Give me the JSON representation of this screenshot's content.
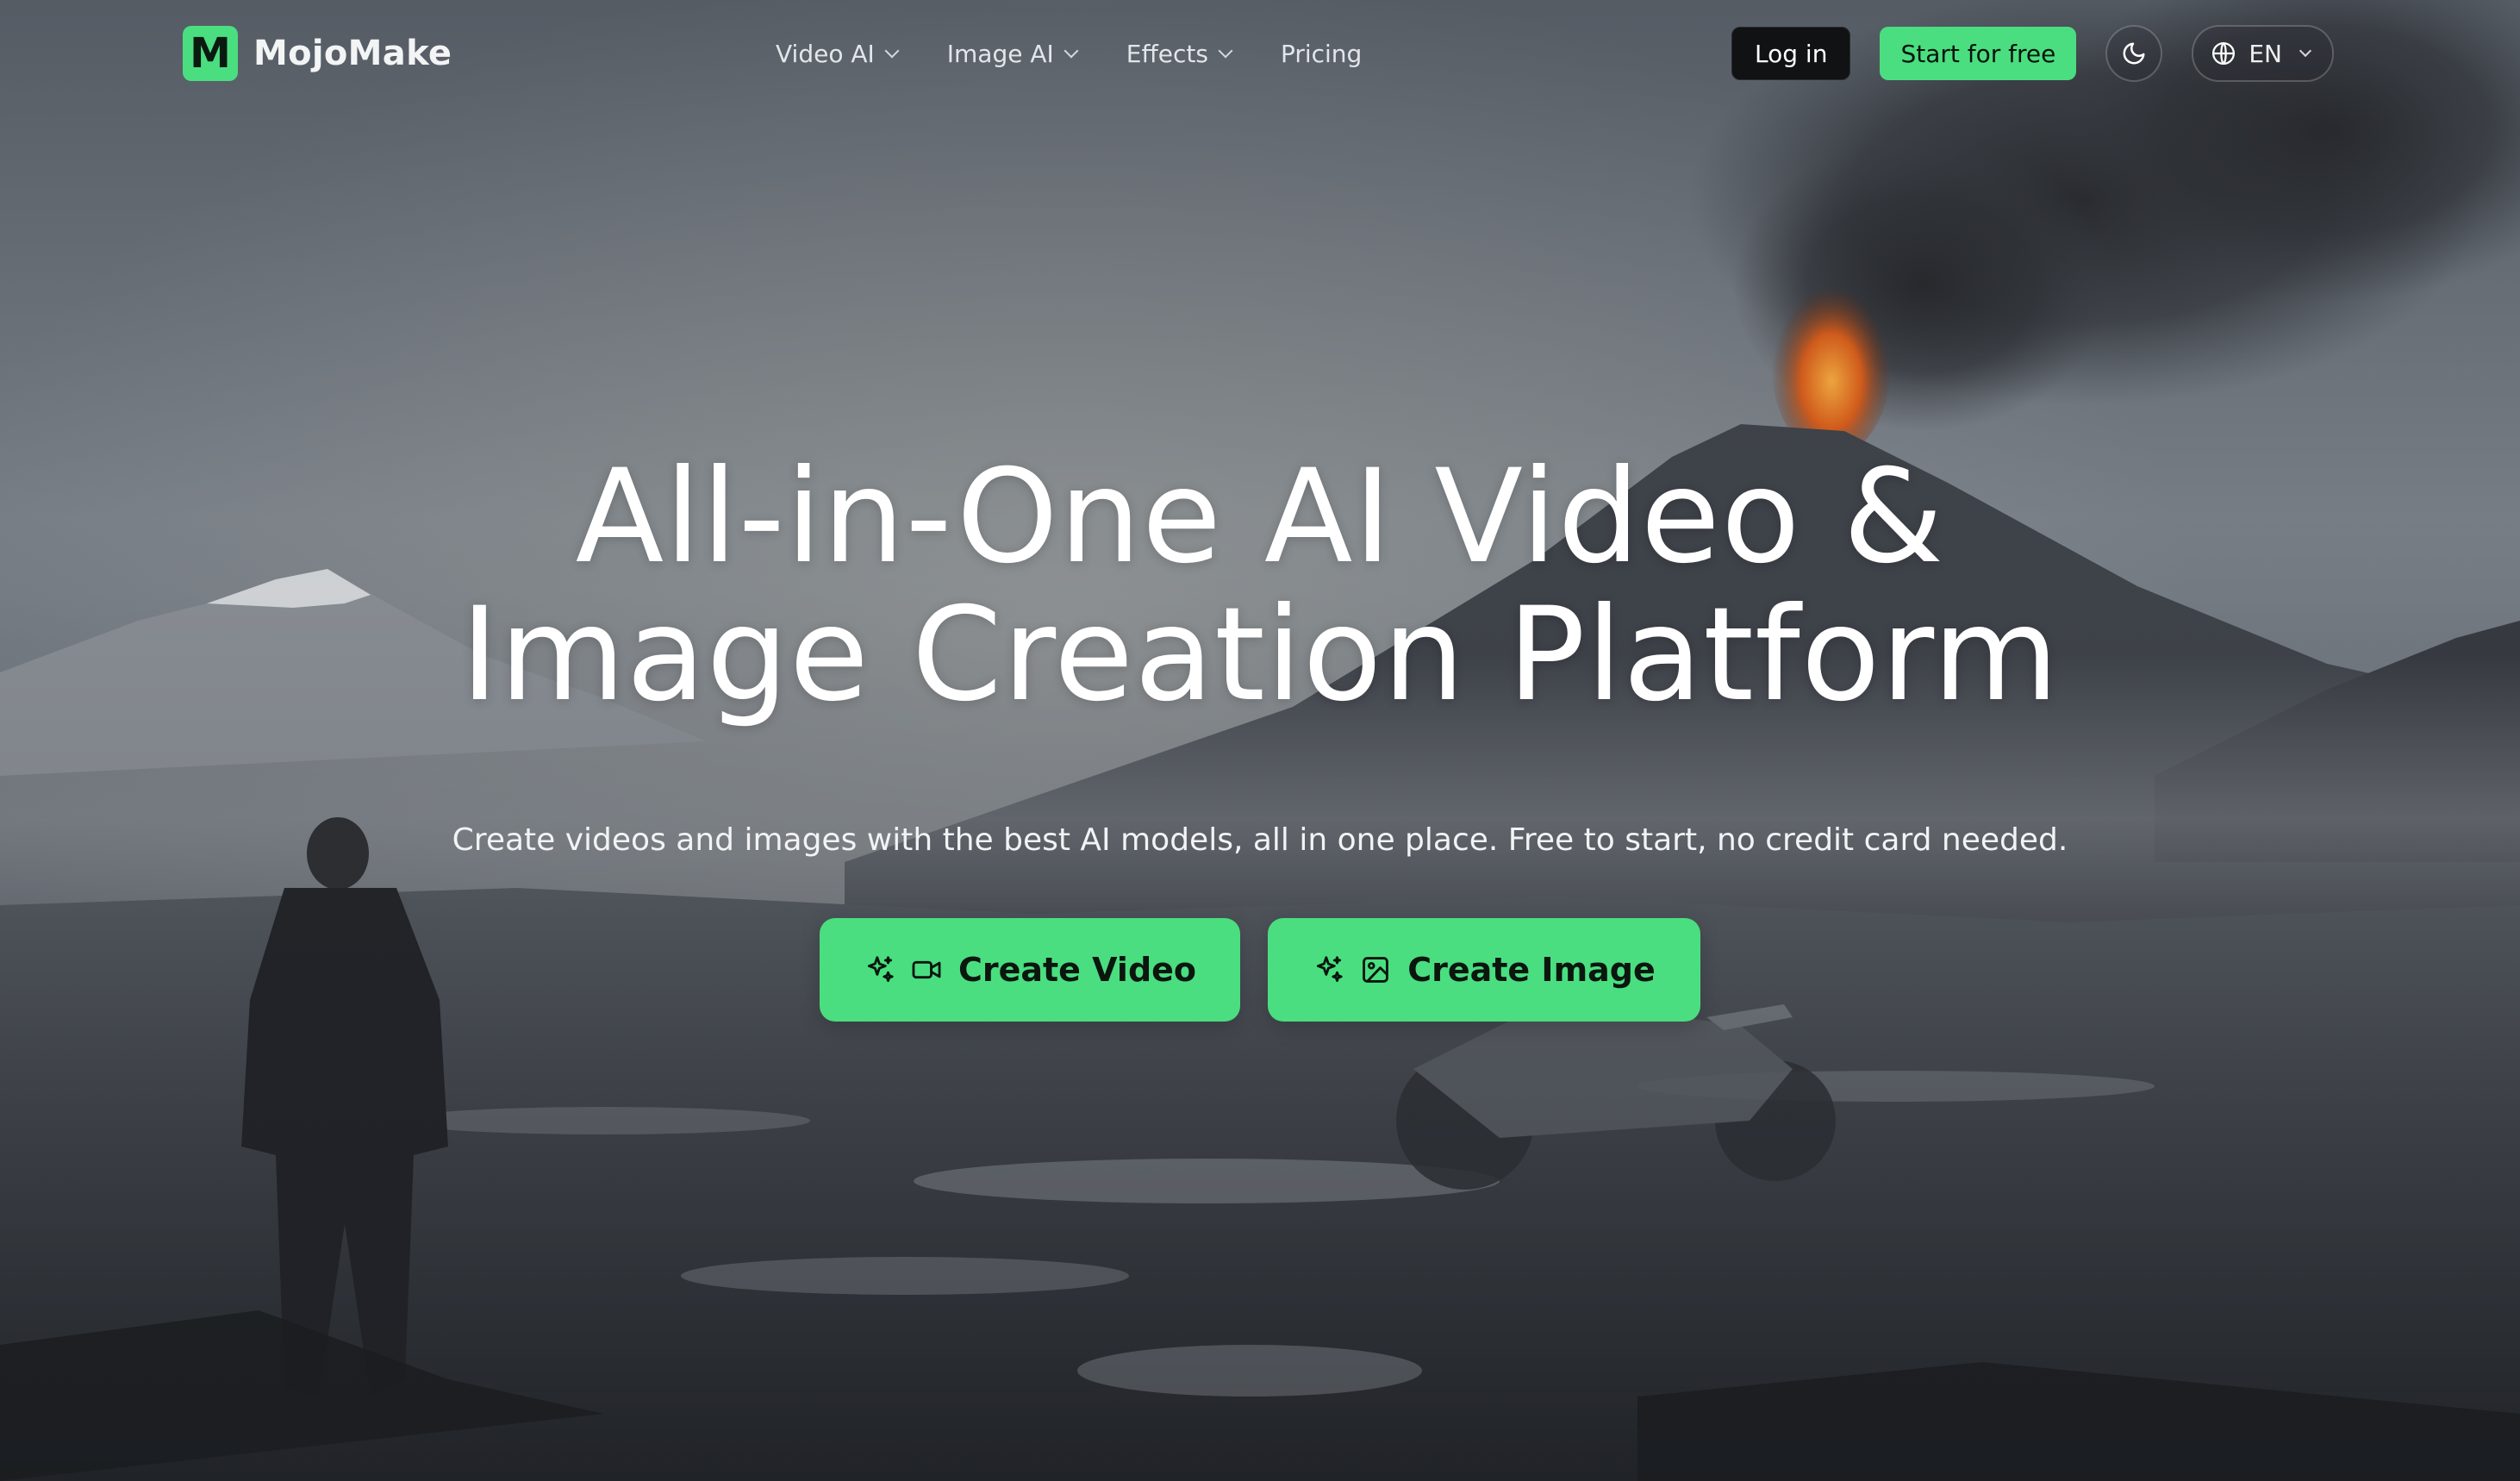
{
  "brand": {
    "logo_letter": "M",
    "name": "MojoMake",
    "accent_color": "#4ade80"
  },
  "nav": {
    "items": [
      {
        "label": "Video AI",
        "has_dropdown": true
      },
      {
        "label": "Image AI",
        "has_dropdown": true
      },
      {
        "label": "Effects",
        "has_dropdown": true
      },
      {
        "label": "Pricing",
        "has_dropdown": false
      }
    ],
    "login_label": "Log in",
    "start_label": "Start for free",
    "theme_icon": "moon-icon",
    "language": {
      "icon": "globe-icon",
      "label": "EN"
    }
  },
  "hero": {
    "title_line1": "All-in-One AI Video &",
    "title_line2": "Image Creation Platform",
    "subtitle": "Create videos and images with the best AI models, all in one place. Free to start, no credit card needed.",
    "cta_video": {
      "label": "Create Video",
      "icons": [
        "sparkles-icon",
        "video-camera-icon"
      ]
    },
    "cta_image": {
      "label": "Create Image",
      "icons": [
        "sparkles-icon",
        "image-icon"
      ]
    }
  }
}
